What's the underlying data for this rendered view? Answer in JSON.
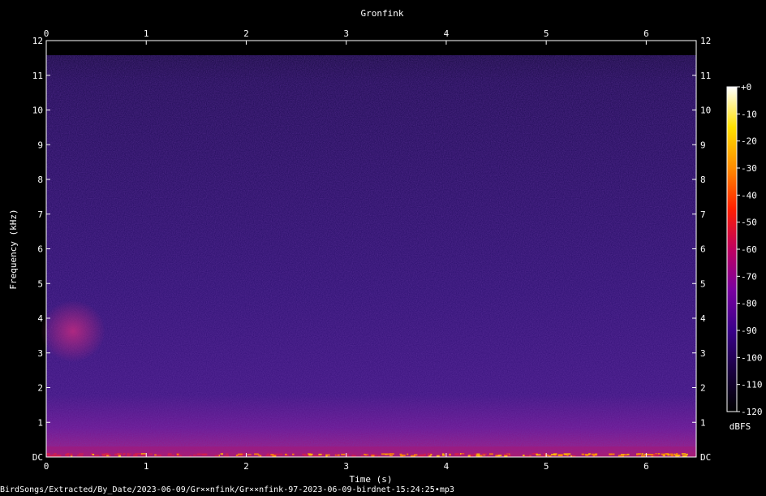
{
  "chart_data": {
    "type": "heatmap",
    "title": "Gronfink",
    "xlabel": "Time (s)",
    "ylabel": "Frequency (kHz)",
    "xlim": [
      0,
      6.5
    ],
    "ylim": [
      0,
      12
    ],
    "x_ticks": [
      "0",
      "1",
      "2",
      "3",
      "4",
      "5",
      "6"
    ],
    "y_ticks": [
      "DC",
      "1",
      "2",
      "3",
      "4",
      "5",
      "6",
      "7",
      "8",
      "9",
      "10",
      "11",
      "12"
    ],
    "colorbar": {
      "label": "dBFS",
      "range": [
        -120,
        0
      ],
      "ticks": [
        "+0",
        "-10",
        "-20",
        "-30",
        "-40",
        "-50",
        "-60",
        "-70",
        "-80",
        "-90",
        "-100",
        "-110",
        "-120"
      ],
      "colors": [
        "#000000",
        "#1a0040",
        "#3a008a",
        "#7a00a0",
        "#c00060",
        "#ff2000",
        "#ff8c00",
        "#ffe000",
        "#ffffff"
      ]
    },
    "grid": false
  },
  "footer": {
    "path": "BirdSongs/Extracted/By_Date/2023-06-09/Gr××nfink/Gr××nfink-97-2023-06-09-birdnet-15:24:25•mp3"
  }
}
